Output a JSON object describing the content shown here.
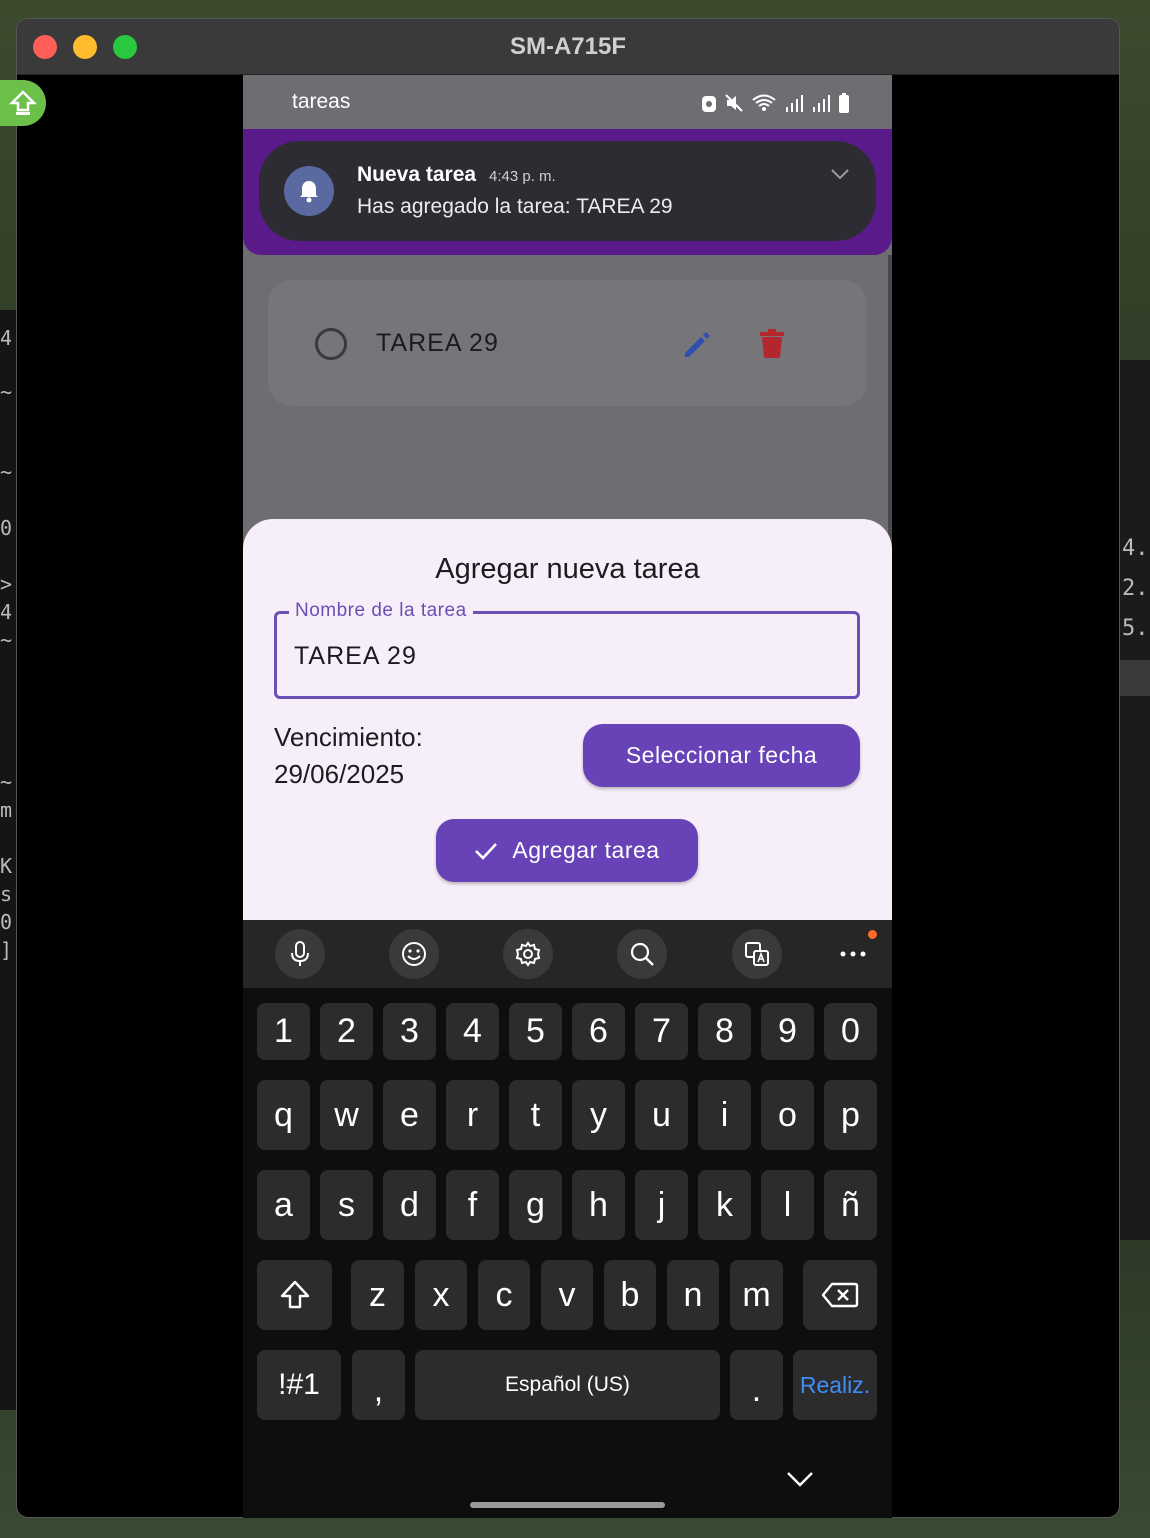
{
  "window": {
    "title": "SM-A715F"
  },
  "status_bar": {
    "app_title": "tareas"
  },
  "notification": {
    "title": "Nueva tarea",
    "time": "4:43 p. m.",
    "body": "Has agregado la tarea: TAREA 29"
  },
  "task_list": [
    {
      "name": "TAREA 29",
      "completed": false
    }
  ],
  "dialog": {
    "title": "Agregar nueva tarea",
    "name_field": {
      "label": "Nombre de la tarea",
      "value": "TAREA 29"
    },
    "due_label": "Vencimiento:",
    "due_date": "29/06/2025",
    "select_date_button": "Seleccionar fecha",
    "add_button": "Agregar tarea"
  },
  "keyboard": {
    "toolbar": [
      "microphone-icon",
      "emoji-icon",
      "settings-icon",
      "search-icon",
      "translate-icon",
      "more-icon"
    ],
    "number_row": [
      "1",
      "2",
      "3",
      "4",
      "5",
      "6",
      "7",
      "8",
      "9",
      "0"
    ],
    "row1": [
      "q",
      "w",
      "e",
      "r",
      "t",
      "y",
      "u",
      "i",
      "o",
      "p"
    ],
    "row2": [
      "a",
      "s",
      "d",
      "f",
      "g",
      "h",
      "j",
      "k",
      "l",
      "ñ"
    ],
    "row3": [
      "z",
      "x",
      "c",
      "v",
      "b",
      "n",
      "m"
    ],
    "symbols_key": "!#1",
    "comma_key": ",",
    "space_key": "Español (US)",
    "period_key": ".",
    "done_key": "Realiz."
  },
  "colors": {
    "primary": "#6842b7",
    "notification_frame": "#5a1a8a",
    "dialog_bg": "#f6eef8",
    "edit_icon": "#2f4fb0",
    "delete_icon": "#b3262c",
    "done_key": "#3e8ef7"
  }
}
